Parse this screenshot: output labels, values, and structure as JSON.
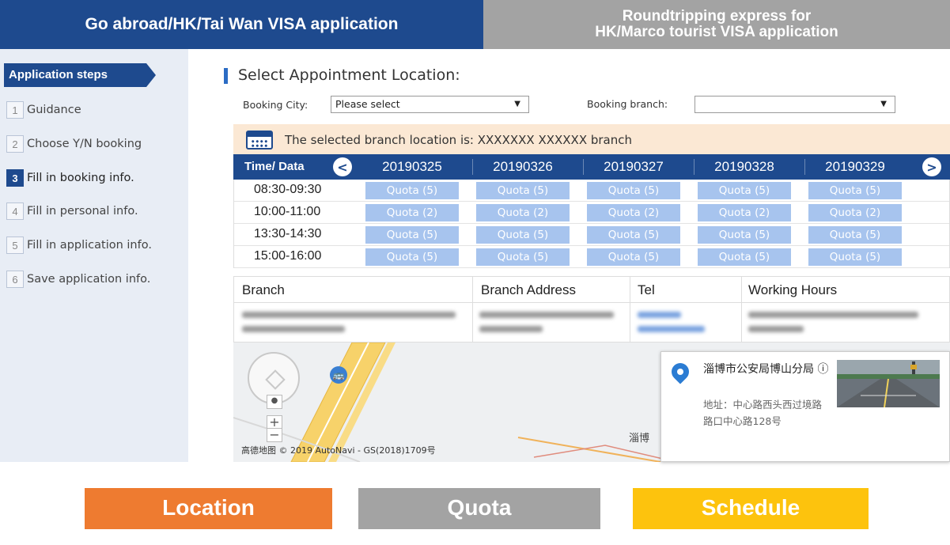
{
  "tabs": {
    "active": "Go abroad/HK/Tai Wan VISA application",
    "inactive_line1": "Roundtripping  express for",
    "inactive_line2": "HK/Marco tourist VISA application"
  },
  "sidebar": {
    "header": "Application steps",
    "steps": [
      {
        "num": "1",
        "label": "Guidance"
      },
      {
        "num": "2",
        "label": "Choose Y/N booking"
      },
      {
        "num": "3",
        "label": "Fill in booking info."
      },
      {
        "num": "4",
        "label": "Fill in personal info."
      },
      {
        "num": "5",
        "label": "Fill in application info."
      },
      {
        "num": "6",
        "label": "Save application info."
      }
    ],
    "current_step": 3
  },
  "main": {
    "section_title": "Select Appointment Location:",
    "booking_city_label": "Booking City:",
    "booking_city_value": "Please select",
    "booking_branch_label": "Booking branch:",
    "booking_branch_value": "",
    "dropdown_glyph": "▼",
    "selected_branch_text": "The selected branch location is:   XXXXXXX XXXXXX  branch"
  },
  "schedule": {
    "time_header": "Time/ Data",
    "prev": "<",
    "next": ">",
    "dates": [
      "20190325",
      "20190326",
      "20190327",
      "20190328",
      "20190329"
    ],
    "rows": [
      {
        "time": "08:30-09:30",
        "quota": "Quota (5)"
      },
      {
        "time": "10:00-11:00",
        "quota": "Quota (2)"
      },
      {
        "time": "13:30-14:30",
        "quota": "Quota (5)"
      },
      {
        "time": "15:00-16:00",
        "quota": "Quota (5)"
      }
    ]
  },
  "branch_table": {
    "headers": [
      "Branch",
      "Branch Address",
      "Tel",
      "Working Hours"
    ]
  },
  "map": {
    "copyright": "高德地图 © 2019 AutoNavi - GS(2018)1709号",
    "zoom_in": "+",
    "zoom_out": "−",
    "bus_icon": "🚌",
    "label": "淄博",
    "popup_title": "淄博市公安局博山分局 ⓘ",
    "popup_address": "地址：中心路西头西过境路路口中心路128号"
  },
  "bottom_buttons": [
    {
      "label": "Location",
      "color": "#ee7b30"
    },
    {
      "label": "Quota",
      "color": "#a3a3a3"
    },
    {
      "label": "Schedule",
      "color": "#fdc30d"
    }
  ],
  "colors": {
    "primary": "#1e4a8e",
    "quota_cell": "#a7c4ee",
    "selected_bar": "#fbe8d4"
  }
}
